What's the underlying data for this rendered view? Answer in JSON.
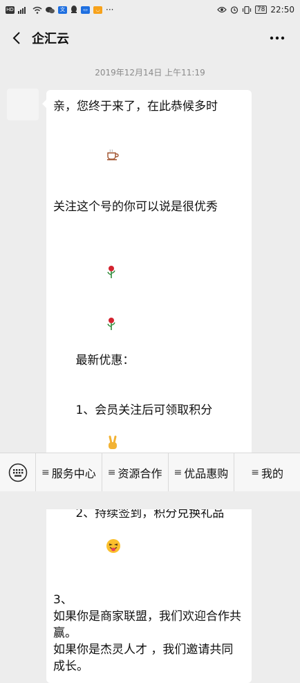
{
  "status_bar": {
    "time": "22:50",
    "battery": "78"
  },
  "header": {
    "title": "企汇云"
  },
  "chat": {
    "timestamp": "2019年12月14日 上午11:19",
    "message_lines": [
      "亲，您终于来了，在此恭候多时",
      "关注这个号的你可以说是很优秀",
      "",
      "最新优惠：",
      "1、会员关注后可领取积分",
      "2、持续签到，积分兑换礼品",
      "3、",
      "如果你是商家联盟，我们欢迎合作共赢。",
      "如果你是杰灵人才 ，我们邀请共同成长。"
    ]
  },
  "menu": {
    "items": [
      {
        "label": "服务中心"
      },
      {
        "label": "资源合作"
      },
      {
        "label": "优品惠购"
      },
      {
        "label": "我的"
      }
    ]
  },
  "icons": {
    "back": "chevron-left-icon",
    "more": "more-dots-icon",
    "keyboard": "keyboard-icon",
    "coffee": "coffee-emoji",
    "rose": "rose-emoji",
    "victory": "victory-hand-emoji",
    "tongue": "tongue-face-emoji"
  }
}
